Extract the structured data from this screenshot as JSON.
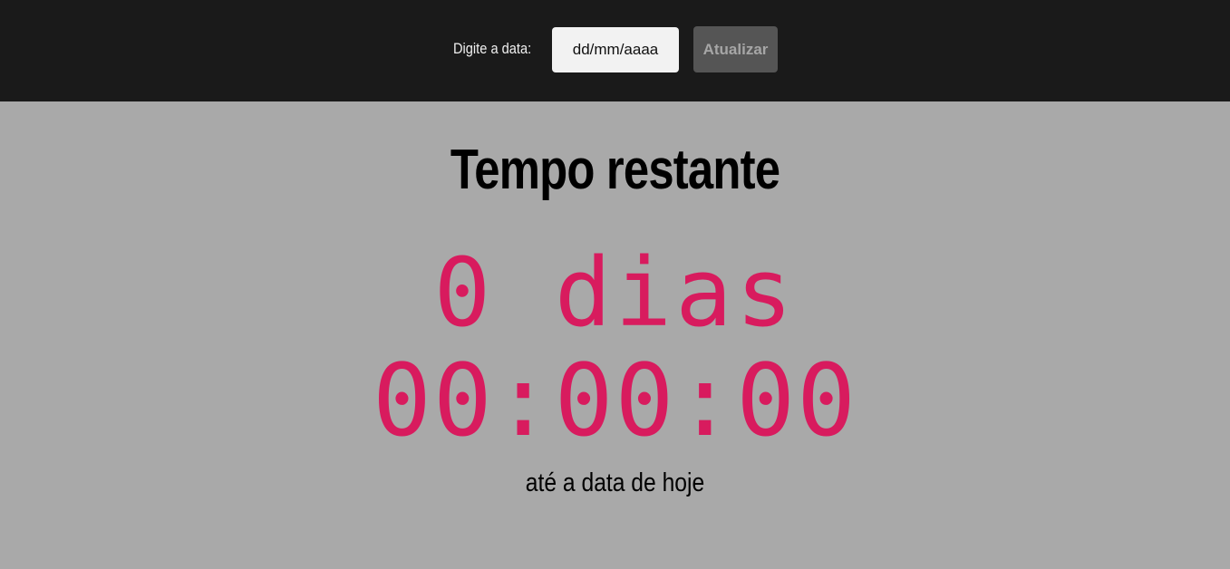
{
  "header": {
    "date_label": "Digite a data:",
    "date_placeholder": "dd/mm/aaaa",
    "update_button_label": "Atualizar"
  },
  "countdown": {
    "title": "Tempo restante",
    "days_text": "0 dias",
    "time_text": "00:00:00",
    "footer_text": "até a data de hoje"
  },
  "colors": {
    "header_background": "#1a1a1a",
    "page_background": "#a9a9a9",
    "digits_accent": "#d81b5e",
    "button_background": "#555555"
  }
}
